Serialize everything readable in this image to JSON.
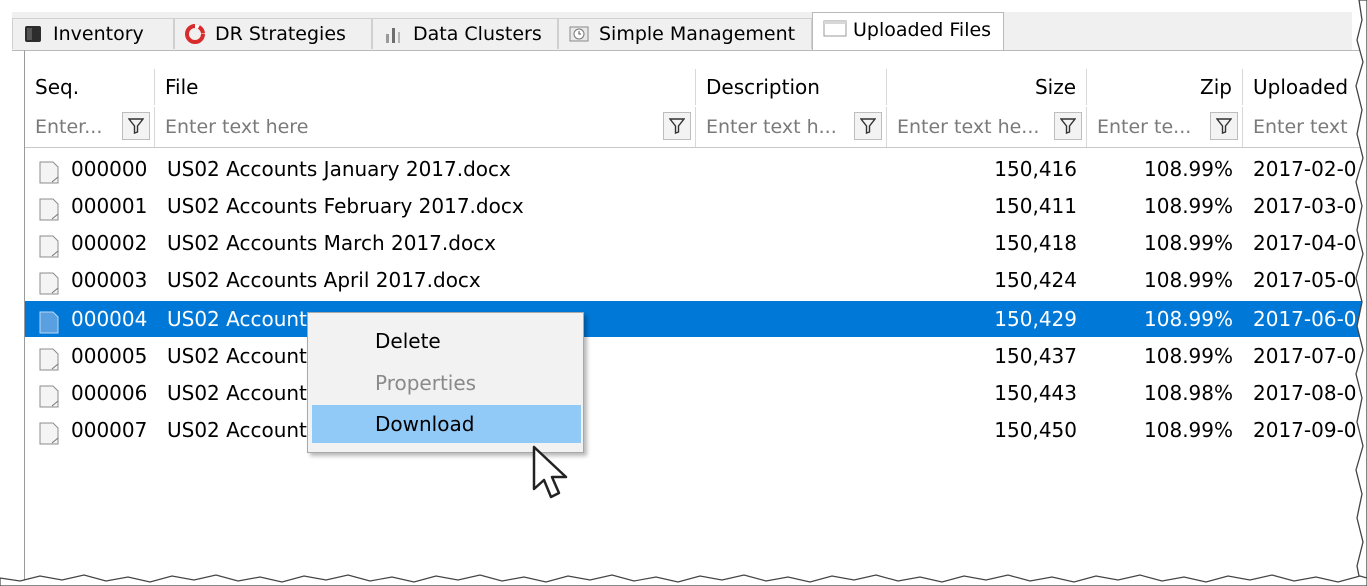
{
  "tabs": [
    {
      "label": "Inventory",
      "icon": "inventory-icon"
    },
    {
      "label": "DR Strategies",
      "icon": "lifebuoy-icon"
    },
    {
      "label": "Data Clusters",
      "icon": "data-clusters-icon"
    },
    {
      "label": "Simple Management",
      "icon": "clock-icon"
    },
    {
      "label": "Uploaded Files",
      "icon": "file-tab-icon",
      "active": true
    }
  ],
  "grid": {
    "columns": [
      {
        "header": "Seq.",
        "filter_placeholder": "Enter..."
      },
      {
        "header": "File",
        "filter_placeholder": "Enter text here"
      },
      {
        "header": "Description",
        "filter_placeholder": "Enter text h..."
      },
      {
        "header": "Size",
        "filter_placeholder": "Enter text he..."
      },
      {
        "header": "Zip",
        "filter_placeholder": "Enter te..."
      },
      {
        "header": "Uploaded",
        "filter_placeholder": "Enter text"
      }
    ],
    "rows": [
      {
        "seq": "000000",
        "file": "US02 Accounts January 2017.docx",
        "size": "150,416",
        "zip": "108.99%",
        "uploaded": "2017-02-0"
      },
      {
        "seq": "000001",
        "file": "US02 Accounts February 2017.docx",
        "size": "150,411",
        "zip": "108.99%",
        "uploaded": "2017-03-0"
      },
      {
        "seq": "000002",
        "file": "US02 Accounts March 2017.docx",
        "size": "150,418",
        "zip": "108.99%",
        "uploaded": "2017-04-0"
      },
      {
        "seq": "000003",
        "file": "US02 Accounts April 2017.docx",
        "size": "150,424",
        "zip": "108.99%",
        "uploaded": "2017-05-0"
      },
      {
        "seq": "000004",
        "file": "US02 Account",
        "size": "150,429",
        "zip": "108.99%",
        "uploaded": "2017-06-0",
        "selected": true
      },
      {
        "seq": "000005",
        "file": "US02 Account",
        "size": "150,437",
        "zip": "108.99%",
        "uploaded": "2017-07-0"
      },
      {
        "seq": "000006",
        "file": "US02 Account",
        "size": "150,443",
        "zip": "108.98%",
        "uploaded": "2017-08-0"
      },
      {
        "seq": "000007",
        "file": "US02 Account",
        "size": "150,450",
        "zip": "108.99%",
        "uploaded": "2017-09-0"
      }
    ]
  },
  "context_menu": {
    "items": [
      {
        "label": "Delete",
        "enabled": true
      },
      {
        "label": "Properties",
        "enabled": false
      },
      {
        "label": "Download",
        "enabled": true,
        "hovered": true
      }
    ]
  },
  "colors": {
    "selection": "#0078d7",
    "menu_hover": "#91c9f7",
    "disabled_text": "#8a8a8a"
  }
}
